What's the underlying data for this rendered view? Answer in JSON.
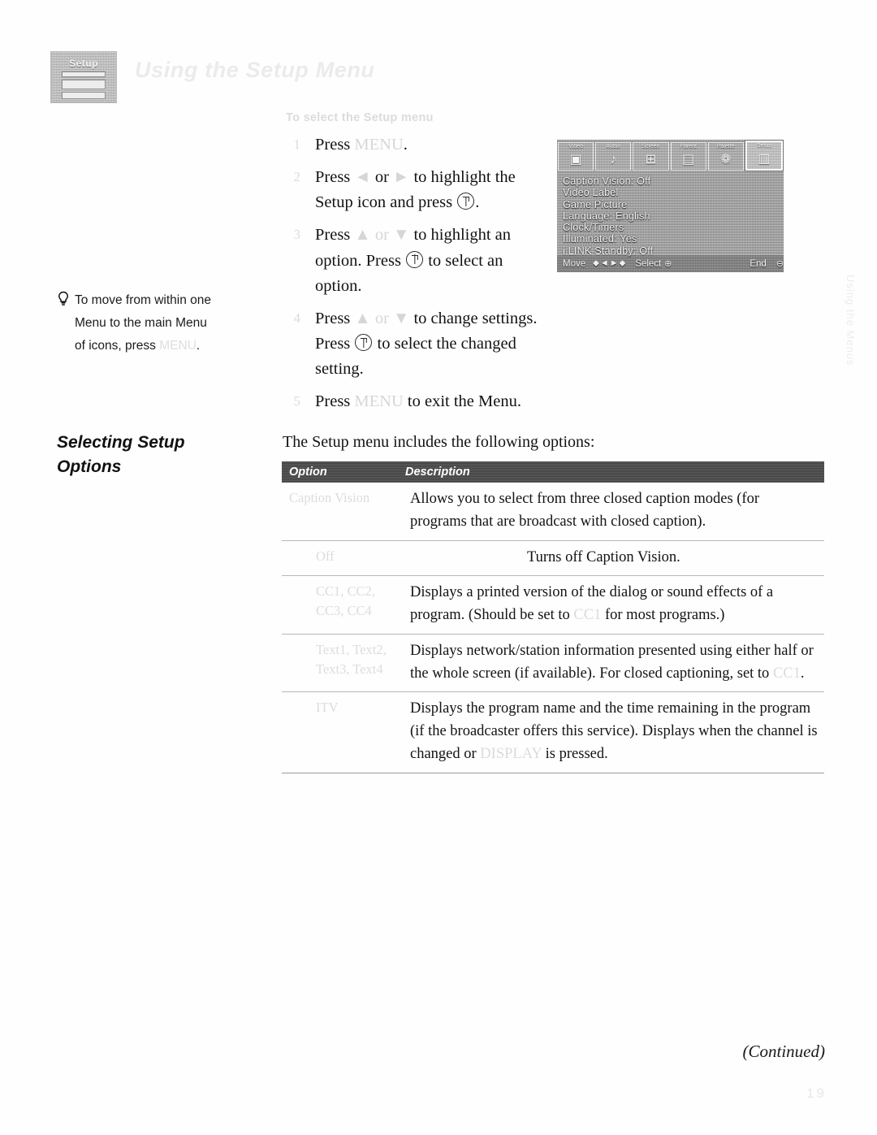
{
  "header": {
    "title": "Using the Setup Menu",
    "thumbnail_label": "Setup"
  },
  "tip": {
    "icon": "lightbulb-icon",
    "line1": "To move from within one",
    "line2": "Menu to the main Menu",
    "line3_prefix": "of icons, press",
    "line3_key": "MENU",
    "line3_suffix": "."
  },
  "steps": {
    "subheading": "To select the Setup menu",
    "items": [
      {
        "num": "1",
        "parts": [
          {
            "type": "text",
            "value": "Press "
          },
          {
            "type": "faded",
            "value": "MENU"
          },
          {
            "type": "text",
            "value": "."
          }
        ]
      },
      {
        "num": "2",
        "parts": [
          {
            "type": "text",
            "value": "Press "
          },
          {
            "type": "faded",
            "value": "◄"
          },
          {
            "type": "text",
            "value": " or "
          },
          {
            "type": "faded",
            "value": "►"
          },
          {
            "type": "text",
            "value": " to highlight the Setup icon and press "
          },
          {
            "type": "key",
            "value": "ENTER"
          },
          {
            "type": "text",
            "value": "."
          }
        ]
      },
      {
        "num": "3",
        "parts": [
          {
            "type": "text",
            "value": "Press "
          },
          {
            "type": "faded",
            "value": "▲ or ▼"
          },
          {
            "type": "text",
            "value": " to highlight an option. Press "
          },
          {
            "type": "key",
            "value": "ENTER"
          },
          {
            "type": "text",
            "value": " to select an option."
          }
        ]
      },
      {
        "num": "4",
        "parts": [
          {
            "type": "text",
            "value": "Press "
          },
          {
            "type": "faded",
            "value": "▲ or ▼"
          },
          {
            "type": "text",
            "value": " to change settings. Press "
          },
          {
            "type": "key",
            "value": "ENTER"
          },
          {
            "type": "text",
            "value": " to select the changed setting."
          }
        ]
      },
      {
        "num": "5",
        "parts": [
          {
            "type": "text",
            "value": "Press "
          },
          {
            "type": "faded",
            "value": "MENU"
          },
          {
            "type": "text",
            "value": " to exit the Menu."
          }
        ]
      }
    ]
  },
  "tv_screen": {
    "icons": [
      {
        "label": "Video",
        "glyph": "▣",
        "active": false
      },
      {
        "label": "Audio",
        "glyph": "♪",
        "active": false
      },
      {
        "label": "Screen",
        "glyph": "⊞",
        "active": false
      },
      {
        "label": "Parent",
        "glyph": "▤",
        "active": false
      },
      {
        "label": "Palette",
        "glyph": "❁",
        "active": false
      },
      {
        "label": "Setup",
        "glyph": "▥",
        "active": true
      }
    ],
    "menu_items": [
      "Caption Vision: Off",
      "Video Label",
      "Game Picture",
      "Language: English",
      "Clock/Timers",
      "Illuminated: Yes",
      "i.LINK Standby: Off"
    ],
    "footer": {
      "move_label": "Move",
      "move_glyph": "⬥◄►⬥",
      "select_label": "Select",
      "select_glyph": "⊕",
      "end_label": "End",
      "end_glyph": "⊖"
    }
  },
  "section": {
    "heading_line1": "Selecting Setup",
    "heading_line2": "Options",
    "intro": "The Setup menu includes the following options:"
  },
  "table": {
    "headers": {
      "option": "Option",
      "description": "Description"
    },
    "rows": [
      {
        "name": "Caption Vision",
        "indent": false,
        "desc_parts": [
          {
            "type": "text",
            "value": "Allows you to select from three closed caption modes (for programs that are broadcast with closed caption)."
          }
        ]
      },
      {
        "name": "Off",
        "indent": true,
        "align_desc": "offset",
        "desc_parts": [
          {
            "type": "text",
            "value": "Turns off Caption Vision."
          }
        ]
      },
      {
        "name": "CC1, CC2, CC3, CC4",
        "indent": true,
        "desc_parts": [
          {
            "type": "text",
            "value": "Displays a printed version of the dialog or sound effects of a program. (Should be set to "
          },
          {
            "type": "faded",
            "value": "CC1"
          },
          {
            "type": "text",
            "value": " for most programs.)"
          }
        ]
      },
      {
        "name": "Text1, Text2, Text3, Text4",
        "indent": true,
        "desc_parts": [
          {
            "type": "text",
            "value": "Displays network/station information presented using either half or the whole screen (if available). For closed captioning, set to "
          },
          {
            "type": "faded",
            "value": "CC1"
          },
          {
            "type": "text",
            "value": "."
          }
        ]
      },
      {
        "name": "ITV",
        "indent": true,
        "desc_parts": [
          {
            "type": "text",
            "value": "Displays the program name and the time remaining in the program (if the broadcaster offers this service). Displays when the channel is changed or "
          },
          {
            "type": "faded",
            "value": "DISPLAY"
          },
          {
            "type": "text",
            "value": " is pressed."
          }
        ]
      }
    ]
  },
  "footer": {
    "continued": "(Continued)",
    "page_number": "19",
    "margin_text": "Using the Menus"
  }
}
